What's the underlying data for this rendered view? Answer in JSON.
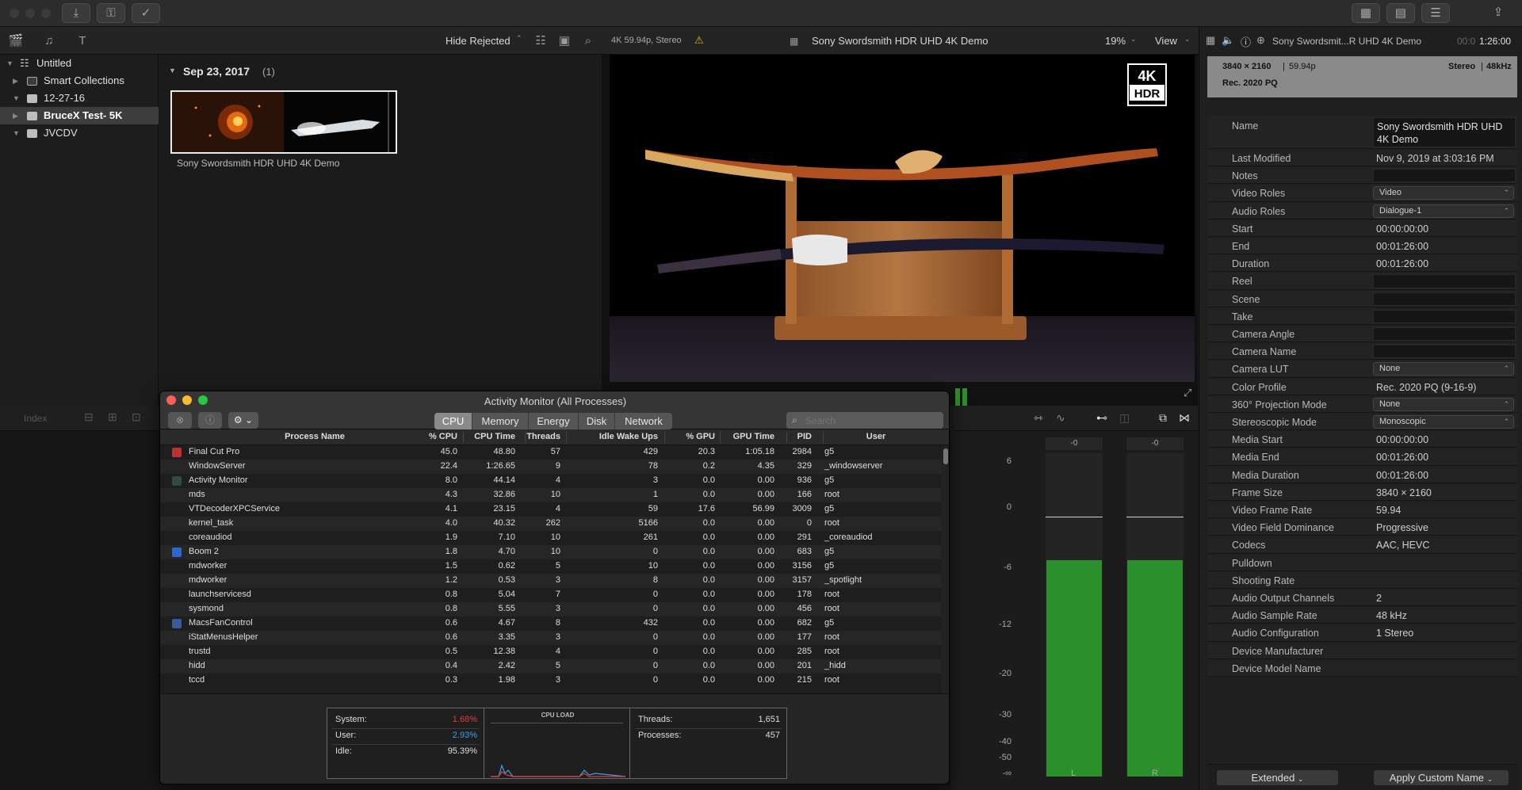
{
  "sidebar": {
    "items": [
      {
        "label": "Untitled"
      },
      {
        "label": "Smart Collections"
      },
      {
        "label": "12-27-16"
      },
      {
        "label": "BruceX Test- 5K"
      },
      {
        "label": "JVCDV"
      }
    ]
  },
  "browser": {
    "filter_label": "Hide Rejected",
    "date_header": "Sep 23, 2017",
    "date_count": "(1)",
    "clip_name": "Sony Swordsmith HDR UHD 4K Demo"
  },
  "viewer": {
    "format": "4K 59.94p, Stereo",
    "title": "Sony Swordsmith HDR UHD 4K Demo",
    "zoom": "19%",
    "view_label": "View",
    "badge_top": "4K",
    "badge_bottom": "HDR"
  },
  "timeline": {
    "index_label": "Index"
  },
  "meters": {
    "scale": [
      "6",
      "0",
      "-6",
      "-12",
      "-20",
      "-30",
      "-40",
      "-50",
      "-∞"
    ],
    "left_peak": "-0",
    "right_peak": "-0",
    "left_label": "L",
    "right_label": "R",
    "left_level": 0.67,
    "right_level": 0.67
  },
  "inspector": {
    "clip_title": "Sony Swordsmit...R UHD 4K Demo",
    "timecode_dim": "00:0",
    "timecode": "1:26:00",
    "resolution": "3840 × 2160",
    "framerate": "59.94p",
    "audio_summary": "Stereo",
    "sample_rate": "48kHz",
    "color_space": "Rec. 2020 PQ",
    "rows": [
      {
        "key": "Name",
        "value": "Sony Swordsmith HDR UHD 4K Demo",
        "kind": "multiline"
      },
      {
        "key": "Last Modified",
        "value": "Nov 9, 2019 at 3:03:16 PM",
        "kind": "text"
      },
      {
        "key": "Notes",
        "value": "",
        "kind": "box"
      },
      {
        "key": "Video Roles",
        "value": "Video",
        "kind": "dropdown"
      },
      {
        "key": "Audio Roles",
        "value": "Dialogue-1",
        "kind": "dropdown"
      },
      {
        "key": "Start",
        "value": "00:00:00:00",
        "kind": "text"
      },
      {
        "key": "End",
        "value": "00:01:26:00",
        "kind": "text"
      },
      {
        "key": "Duration",
        "value": "00:01:26:00",
        "kind": "text"
      },
      {
        "key": "Reel",
        "value": "",
        "kind": "box"
      },
      {
        "key": "Scene",
        "value": "",
        "kind": "box"
      },
      {
        "key": "Take",
        "value": "",
        "kind": "box"
      },
      {
        "key": "Camera Angle",
        "value": "",
        "kind": "box"
      },
      {
        "key": "Camera Name",
        "value": "",
        "kind": "box"
      },
      {
        "key": "Camera LUT",
        "value": "None",
        "kind": "dropdown"
      },
      {
        "key": "Color Profile",
        "value": "Rec. 2020 PQ (9-16-9)",
        "kind": "text"
      },
      {
        "key": "360° Projection Mode",
        "value": "None",
        "kind": "dropdown"
      },
      {
        "key": "Stereoscopic Mode",
        "value": "Monoscopic",
        "kind": "dropdown"
      },
      {
        "key": "Media Start",
        "value": "00:00:00:00",
        "kind": "text"
      },
      {
        "key": "Media End",
        "value": "00:01:26:00",
        "kind": "text"
      },
      {
        "key": "Media Duration",
        "value": "00:01:26:00",
        "kind": "text"
      },
      {
        "key": "Frame Size",
        "value": "3840 × 2160",
        "kind": "text"
      },
      {
        "key": "Video Frame Rate",
        "value": "59.94",
        "kind": "text"
      },
      {
        "key": "Video Field Dominance",
        "value": "Progressive",
        "kind": "text"
      },
      {
        "key": "Codecs",
        "value": "AAC, HEVC",
        "kind": "text"
      },
      {
        "key": "Pulldown",
        "value": "",
        "kind": "text"
      },
      {
        "key": "Shooting Rate",
        "value": "",
        "kind": "text"
      },
      {
        "key": "Audio Output Channels",
        "value": "2",
        "kind": "text"
      },
      {
        "key": "Audio Sample Rate",
        "value": "48 kHz",
        "kind": "text"
      },
      {
        "key": "Audio Configuration",
        "value": "1 Stereo",
        "kind": "text"
      },
      {
        "key": "Device Manufacturer",
        "value": "",
        "kind": "text"
      },
      {
        "key": "Device Model Name",
        "value": "",
        "kind": "text"
      }
    ],
    "footer_left": "Extended",
    "footer_right": "Apply Custom Name"
  },
  "activity_monitor": {
    "title": "Activity Monitor (All Processes)",
    "tabs": [
      "CPU",
      "Memory",
      "Energy",
      "Disk",
      "Network"
    ],
    "active_tab": "CPU",
    "search_placeholder": "Search",
    "columns": [
      "Process Name",
      "% CPU",
      "CPU Time",
      "Threads",
      "Idle Wake Ups",
      "% GPU",
      "GPU Time",
      "PID",
      "User"
    ],
    "rows": [
      [
        "Final Cut Pro",
        "45.0",
        "48.80",
        "57",
        "429",
        "20.3",
        "1:05.18",
        "2984",
        "g5"
      ],
      [
        "WindowServer",
        "22.4",
        "1:26.65",
        "9",
        "78",
        "0.2",
        "4.35",
        "329",
        "_windowserver"
      ],
      [
        "Activity Monitor",
        "8.0",
        "44.14",
        "4",
        "3",
        "0.0",
        "0.00",
        "936",
        "g5"
      ],
      [
        "mds",
        "4.3",
        "32.86",
        "10",
        "1",
        "0.0",
        "0.00",
        "166",
        "root"
      ],
      [
        "VTDecoderXPCService",
        "4.1",
        "23.15",
        "4",
        "59",
        "17.6",
        "56.99",
        "3009",
        "g5"
      ],
      [
        "kernel_task",
        "4.0",
        "40.32",
        "262",
        "5166",
        "0.0",
        "0.00",
        "0",
        "root"
      ],
      [
        "coreaudiod",
        "1.9",
        "7.10",
        "10",
        "261",
        "0.0",
        "0.00",
        "291",
        "_coreaudiod"
      ],
      [
        "Boom 2",
        "1.8",
        "4.70",
        "10",
        "0",
        "0.0",
        "0.00",
        "683",
        "g5"
      ],
      [
        "mdworker",
        "1.5",
        "0.62",
        "5",
        "10",
        "0.0",
        "0.00",
        "3156",
        "g5"
      ],
      [
        "mdworker",
        "1.2",
        "0.53",
        "3",
        "8",
        "0.0",
        "0.00",
        "3157",
        "_spotlight"
      ],
      [
        "launchservicesd",
        "0.8",
        "5.04",
        "7",
        "0",
        "0.0",
        "0.00",
        "178",
        "root"
      ],
      [
        "sysmond",
        "0.8",
        "5.55",
        "3",
        "0",
        "0.0",
        "0.00",
        "456",
        "root"
      ],
      [
        "MacsFanControl",
        "0.6",
        "4.67",
        "8",
        "432",
        "0.0",
        "0.00",
        "682",
        "g5"
      ],
      [
        "iStatMenusHelper",
        "0.6",
        "3.35",
        "3",
        "0",
        "0.0",
        "0.00",
        "177",
        "root"
      ],
      [
        "trustd",
        "0.5",
        "12.38",
        "4",
        "0",
        "0.0",
        "0.00",
        "285",
        "root"
      ],
      [
        "hidd",
        "0.4",
        "2.42",
        "5",
        "0",
        "0.0",
        "0.00",
        "201",
        "_hidd"
      ],
      [
        "tccd",
        "0.3",
        "1.98",
        "3",
        "0",
        "0.0",
        "0.00",
        "215",
        "root"
      ]
    ],
    "footer": {
      "system_label": "System:",
      "system_value": "1.68%",
      "user_label": "User:",
      "user_value": "2.93%",
      "idle_label": "Idle:",
      "idle_value": "95.39%",
      "cpu_load_label": "CPU LOAD",
      "threads_label": "Threads:",
      "threads_value": "1,651",
      "processes_label": "Processes:",
      "processes_value": "457"
    },
    "colors": {
      "system": "#e03c3c",
      "user": "#3aa0e8"
    }
  }
}
